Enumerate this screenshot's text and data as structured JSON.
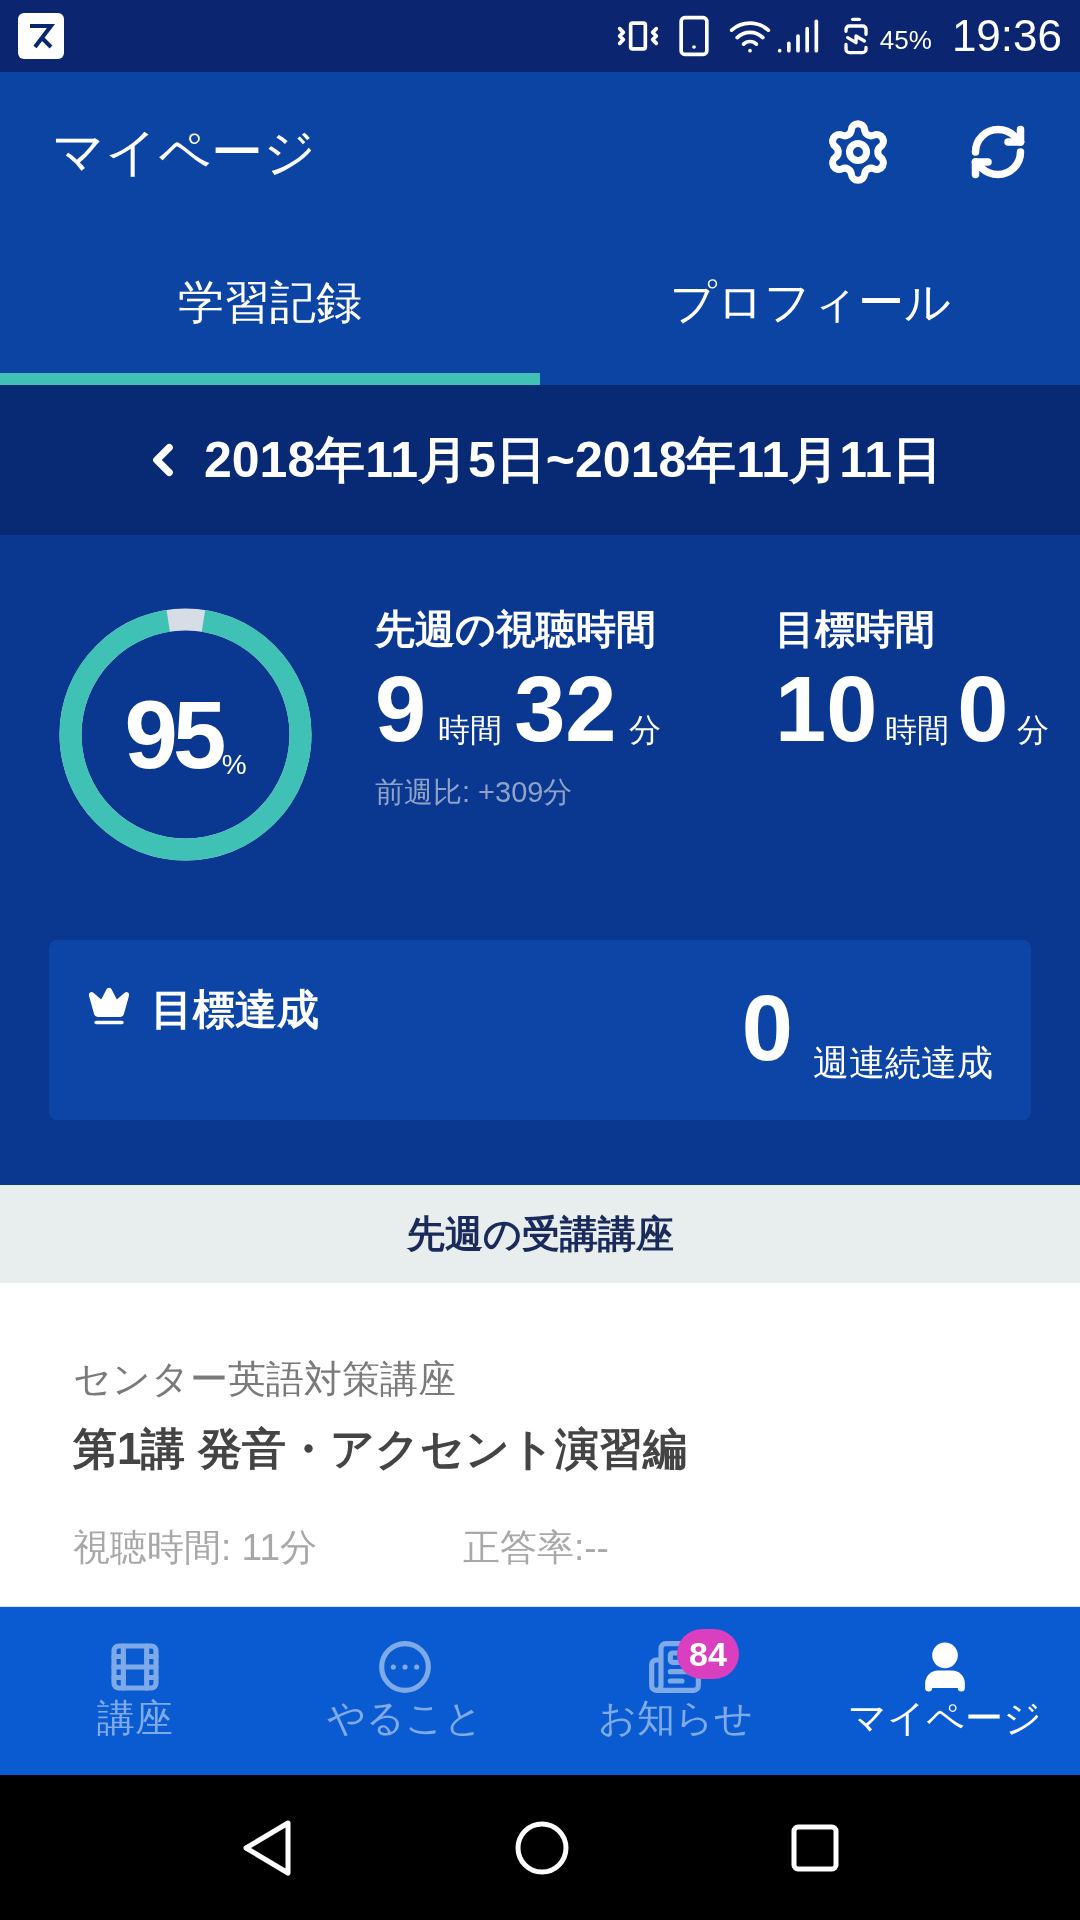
{
  "status_bar": {
    "battery": "45%",
    "time": "19:36"
  },
  "header": {
    "title": "マイページ"
  },
  "tabs": [
    {
      "label": "学習記録",
      "selected": true
    },
    {
      "label": "プロフィール",
      "selected": false
    }
  ],
  "week_range": "2018年11月5日~2018年11月11日",
  "summary": {
    "ring": {
      "level": 0.95,
      "value": "95",
      "unit": "%"
    },
    "watched": {
      "label": "先週の視聴時間",
      "hours": "9",
      "hours_unit": "時間",
      "minutes": "32",
      "minutes_unit": "分",
      "comparison": "前週比: +309分"
    },
    "target": {
      "label": "目標時間",
      "hours": "10",
      "hours_unit": "時間",
      "minutes": "0",
      "minutes_unit": "分"
    }
  },
  "goal_card": {
    "label": "目標達成",
    "count": "0",
    "count_unit": "週連続達成"
  },
  "section_title": "先週の受講講座",
  "course": {
    "series": "センター英語対策講座",
    "title": "第1講 発音・アクセント演習編",
    "watch_time": "視聴時間: 11分",
    "accuracy": "正答率:--"
  },
  "bottom_nav": [
    {
      "kind": "film",
      "label": "講座",
      "selected": false
    },
    {
      "kind": "dots",
      "label": "やること",
      "selected": false
    },
    {
      "kind": "news",
      "label": "お知らせ",
      "selected": false,
      "badge": "84"
    },
    {
      "kind": "person",
      "label": "マイページ",
      "selected": true
    }
  ]
}
